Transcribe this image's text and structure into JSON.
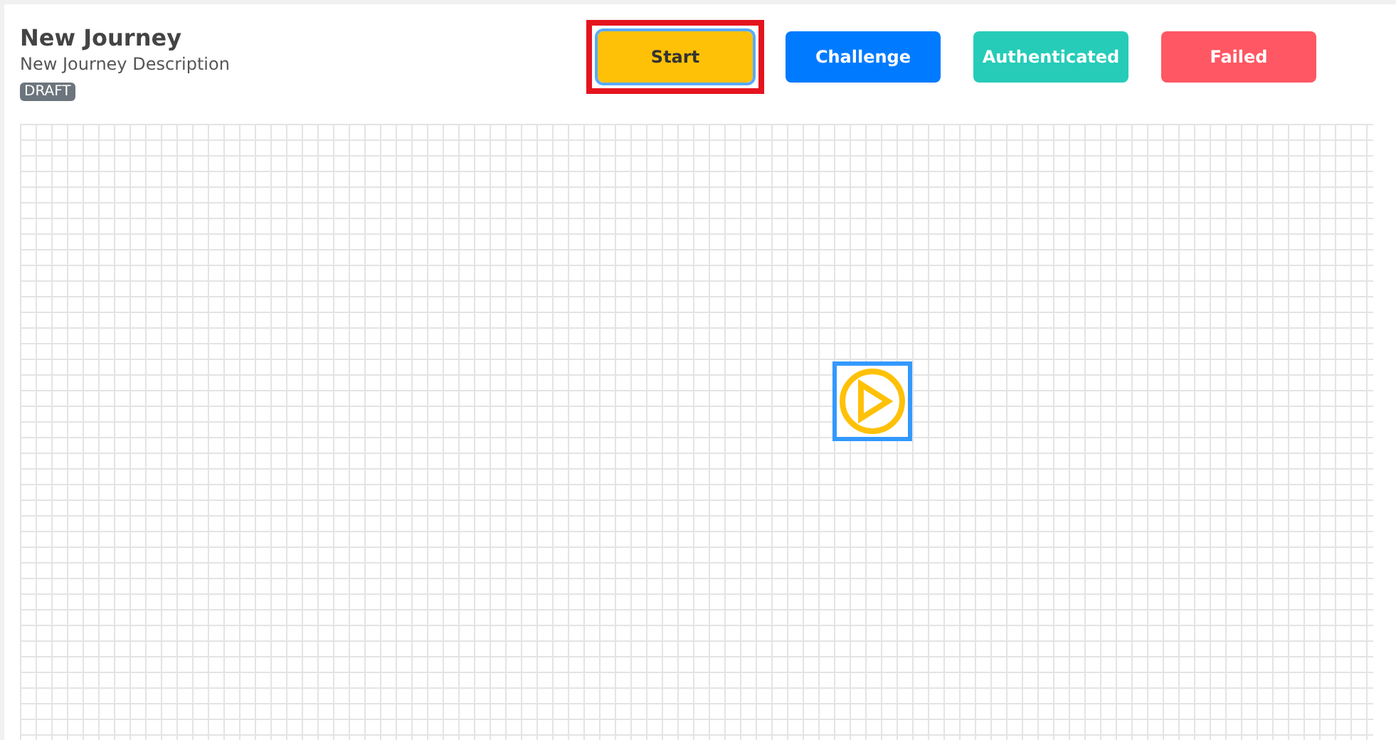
{
  "journey": {
    "title": "New Journey",
    "description": "New Journey Description",
    "status": "DRAFT"
  },
  "node_types": [
    {
      "label": "Start",
      "color": "#ffc107",
      "selected": true
    },
    {
      "label": "Challenge",
      "color": "#007bff",
      "selected": false
    },
    {
      "label": "Authenticated",
      "color": "#26ccb8",
      "selected": false
    },
    {
      "label": "Failed",
      "color": "#ff5763",
      "selected": false
    }
  ],
  "canvas": {
    "nodes": [
      {
        "kind": "start",
        "selected": true
      }
    ]
  }
}
